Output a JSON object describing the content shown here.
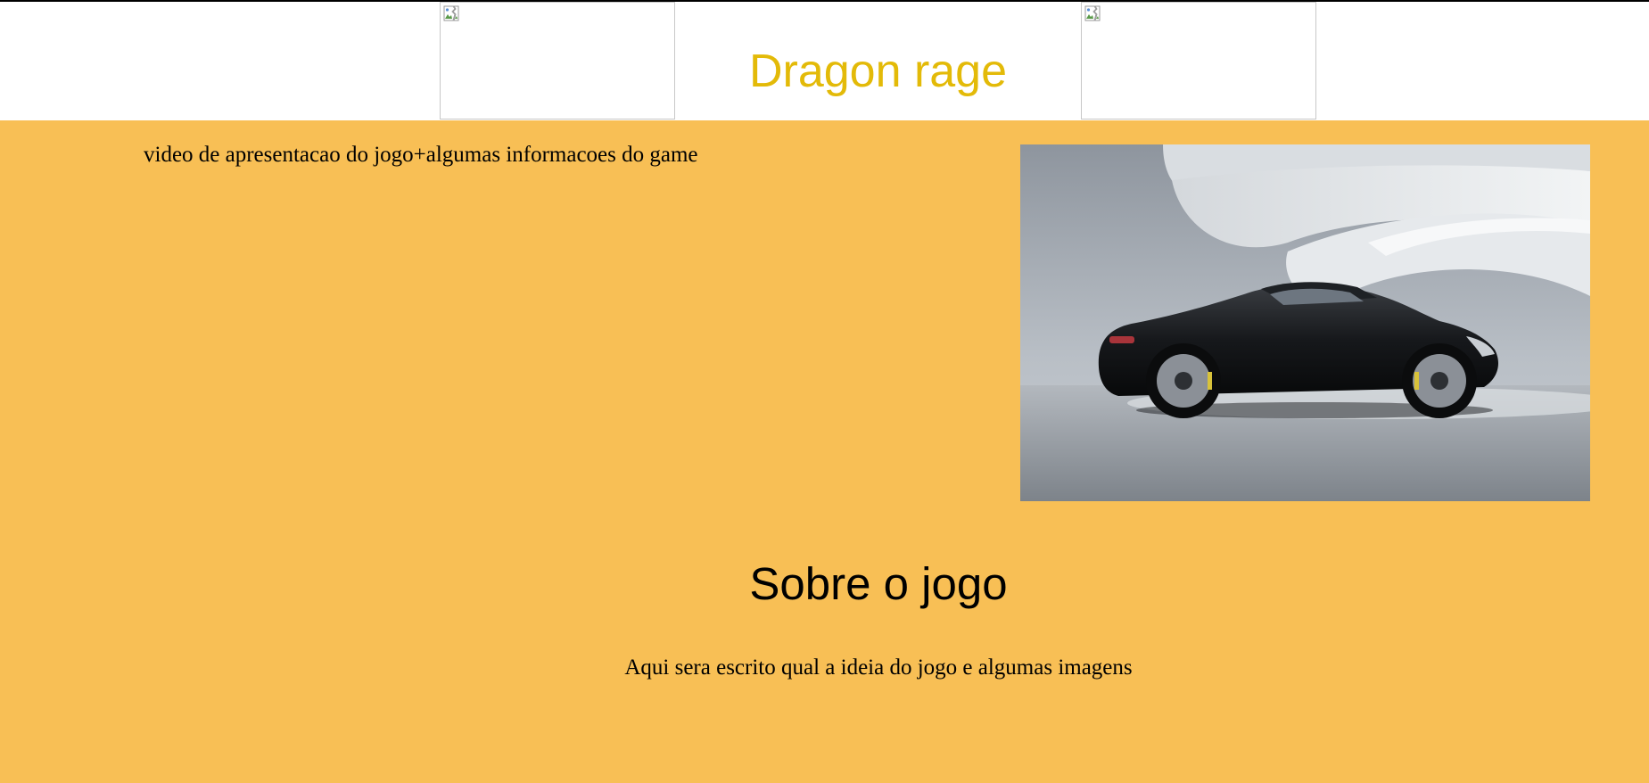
{
  "header": {
    "title": "Dragon rage",
    "title_color": "#e3ba08",
    "left_image_icon": "broken-image-icon",
    "right_image_icon": "broken-image-icon"
  },
  "main": {
    "background_color": "#f8bf55",
    "intro_text": "video de apresentacao do jogo+algumas informacoes do game",
    "hero_image_subject": "black-sports-car-photo",
    "section_heading": "Sobre o jogo",
    "section_text": "Aqui sera escrito qual a ideia do jogo e algumas imagens"
  }
}
